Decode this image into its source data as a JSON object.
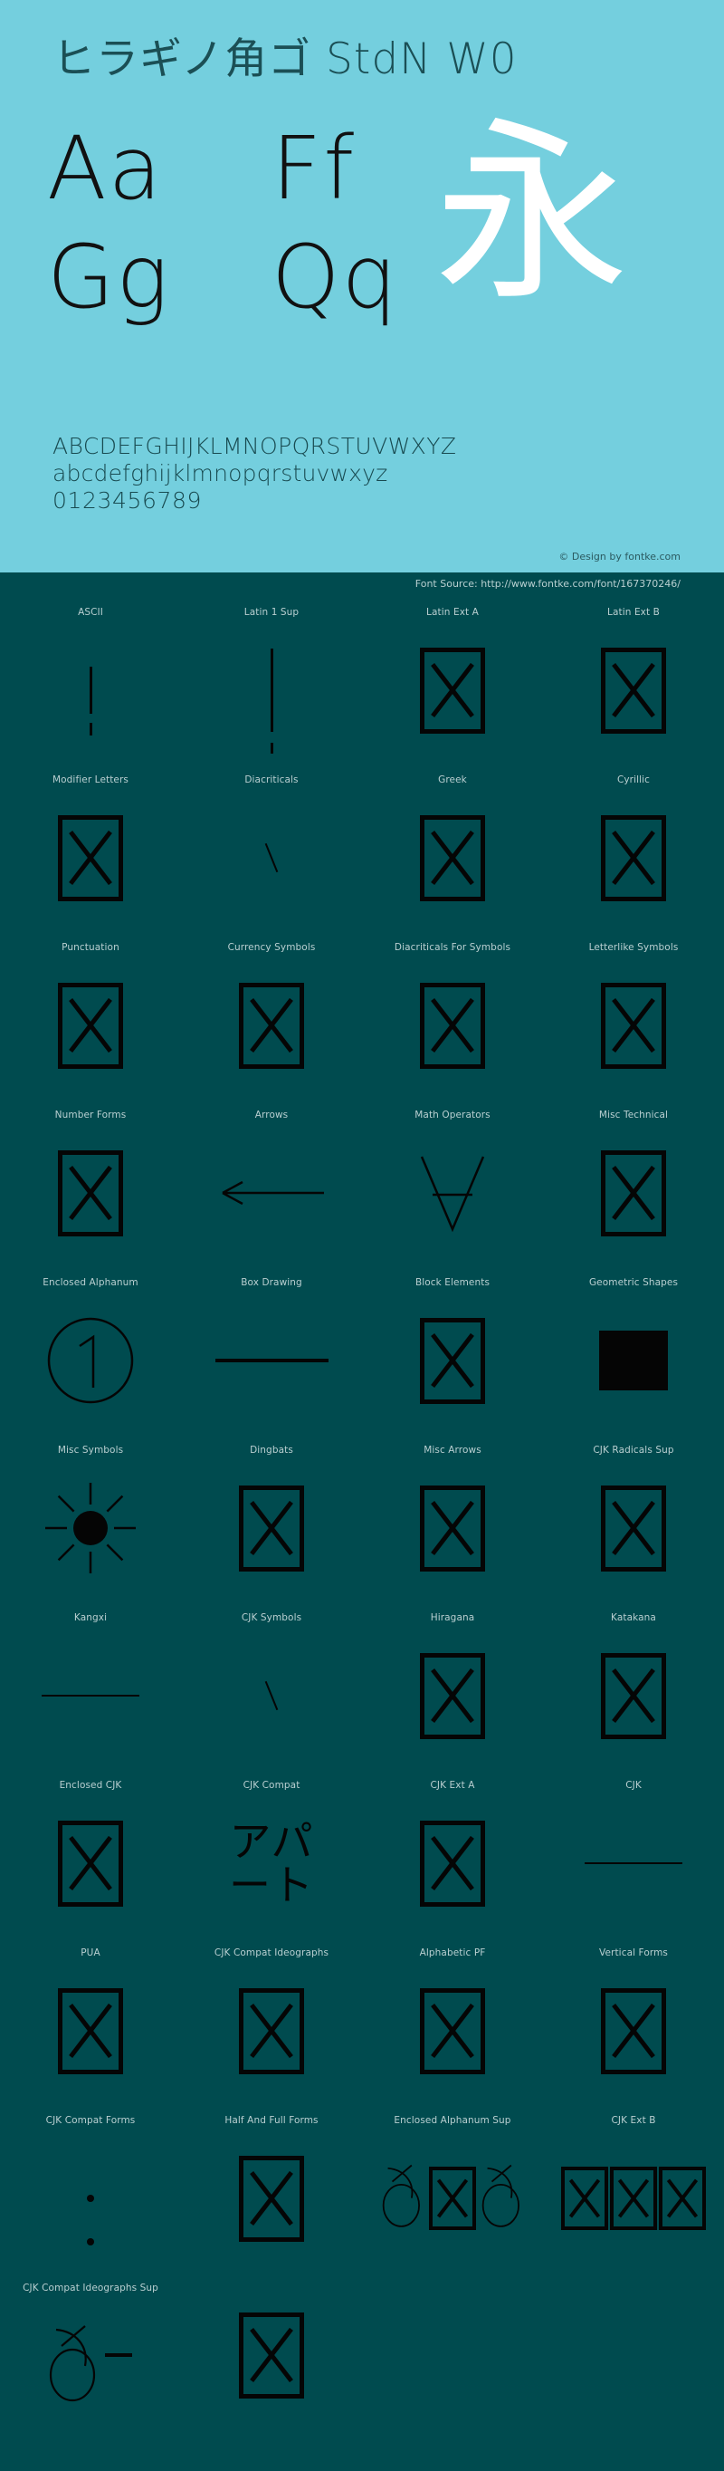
{
  "hero": {
    "title": "ヒラギノ角ゴ StdN W0",
    "samples": [
      "Aa",
      "Ff",
      "Gg",
      "Qq"
    ],
    "kanji": "永",
    "uppercase": "ABCDEFGHIJKLMNOPQRSTUVWXYZ",
    "lowercase": "abcdefghijklmnopqrstuvwxyz",
    "digits": "0123456789",
    "credit": "© Design by fontke.com",
    "background_color": "#74cfde",
    "title_color": "#1b4f55",
    "kanji_color": "#ffffff"
  },
  "source": {
    "text": "Font Source: http://www.fontke.com/font/167370246/",
    "background_color": "#004b4f",
    "text_color": "#b8cfd0"
  },
  "blocks": {
    "label_color": "#b9cfd1",
    "glyph_color": "#050505",
    "rows": [
      [
        {
          "label": "ASCII",
          "glyph": "vbar"
        },
        {
          "label": "Latin 1 Sup",
          "glyph": "excl-tall"
        },
        {
          "label": "Latin Ext A",
          "glyph": "tofu"
        },
        {
          "label": "Latin Ext B",
          "glyph": "tofu"
        }
      ],
      [
        {
          "label": "Modifier Letters",
          "glyph": "tofu"
        },
        {
          "label": "Diacriticals",
          "glyph": "slash-small"
        },
        {
          "label": "Greek",
          "glyph": "tofu"
        },
        {
          "label": "Cyrillic",
          "glyph": "tofu"
        }
      ],
      [
        {
          "label": "Punctuation",
          "glyph": "tofu"
        },
        {
          "label": "Currency Symbols",
          "glyph": "tofu"
        },
        {
          "label": "Diacriticals For Symbols",
          "glyph": "tofu"
        },
        {
          "label": "Letterlike Symbols",
          "glyph": "tofu"
        }
      ],
      [
        {
          "label": "Number Forms",
          "glyph": "tofu"
        },
        {
          "label": "Arrows",
          "glyph": "arrow-left"
        },
        {
          "label": "Math Operators",
          "glyph": "nabla-a"
        },
        {
          "label": "Misc Technical",
          "glyph": "tofu"
        }
      ],
      [
        {
          "label": "Enclosed Alphanum",
          "glyph": "circled-one",
          "glyph_text": "①"
        },
        {
          "label": "Box Drawing",
          "glyph": "hline"
        },
        {
          "label": "Block Elements",
          "glyph": "tofu"
        },
        {
          "label": "Geometric Shapes",
          "glyph": "solid-block"
        }
      ],
      [
        {
          "label": "Misc Symbols",
          "glyph": "sun"
        },
        {
          "label": "Dingbats",
          "glyph": "tofu"
        },
        {
          "label": "Misc Arrows",
          "glyph": "tofu"
        },
        {
          "label": "CJK Radicals Sup",
          "glyph": "tofu"
        }
      ],
      [
        {
          "label": "Kangxi",
          "glyph": "hline-thin"
        },
        {
          "label": "CJK Symbols",
          "glyph": "slash-small"
        },
        {
          "label": "Hiragana",
          "glyph": "tofu"
        },
        {
          "label": "Katakana",
          "glyph": "tofu"
        }
      ],
      [
        {
          "label": "Enclosed CJK",
          "glyph": "tofu"
        },
        {
          "label": "CJK Compat",
          "glyph": "katakana",
          "glyph_text": "アパート"
        },
        {
          "label": "CJK Ext A",
          "glyph": "tofu"
        },
        {
          "label": "CJK",
          "glyph": "hline-thin"
        }
      ],
      [
        {
          "label": "PUA",
          "glyph": "tofu"
        },
        {
          "label": "CJK Compat Ideographs",
          "glyph": "tofu"
        },
        {
          "label": "Alphabetic PF",
          "glyph": "tofu"
        },
        {
          "label": "Vertical Forms",
          "glyph": "tofu"
        }
      ],
      [
        {
          "label": "CJK Compat Forms",
          "glyph": "dots"
        },
        {
          "label": "Half And Full Forms",
          "glyph": "tofu"
        },
        {
          "label": "Enclosed Alphanum Sup",
          "glyph": "ohook-tofu"
        },
        {
          "label": "CJK Ext B",
          "glyph": "multi-tofu"
        }
      ],
      [
        {
          "label": "CJK Compat Ideographs Sup",
          "glyph": "ohook-macron"
        },
        {
          "label": "",
          "glyph": "tofu"
        }
      ]
    ]
  }
}
